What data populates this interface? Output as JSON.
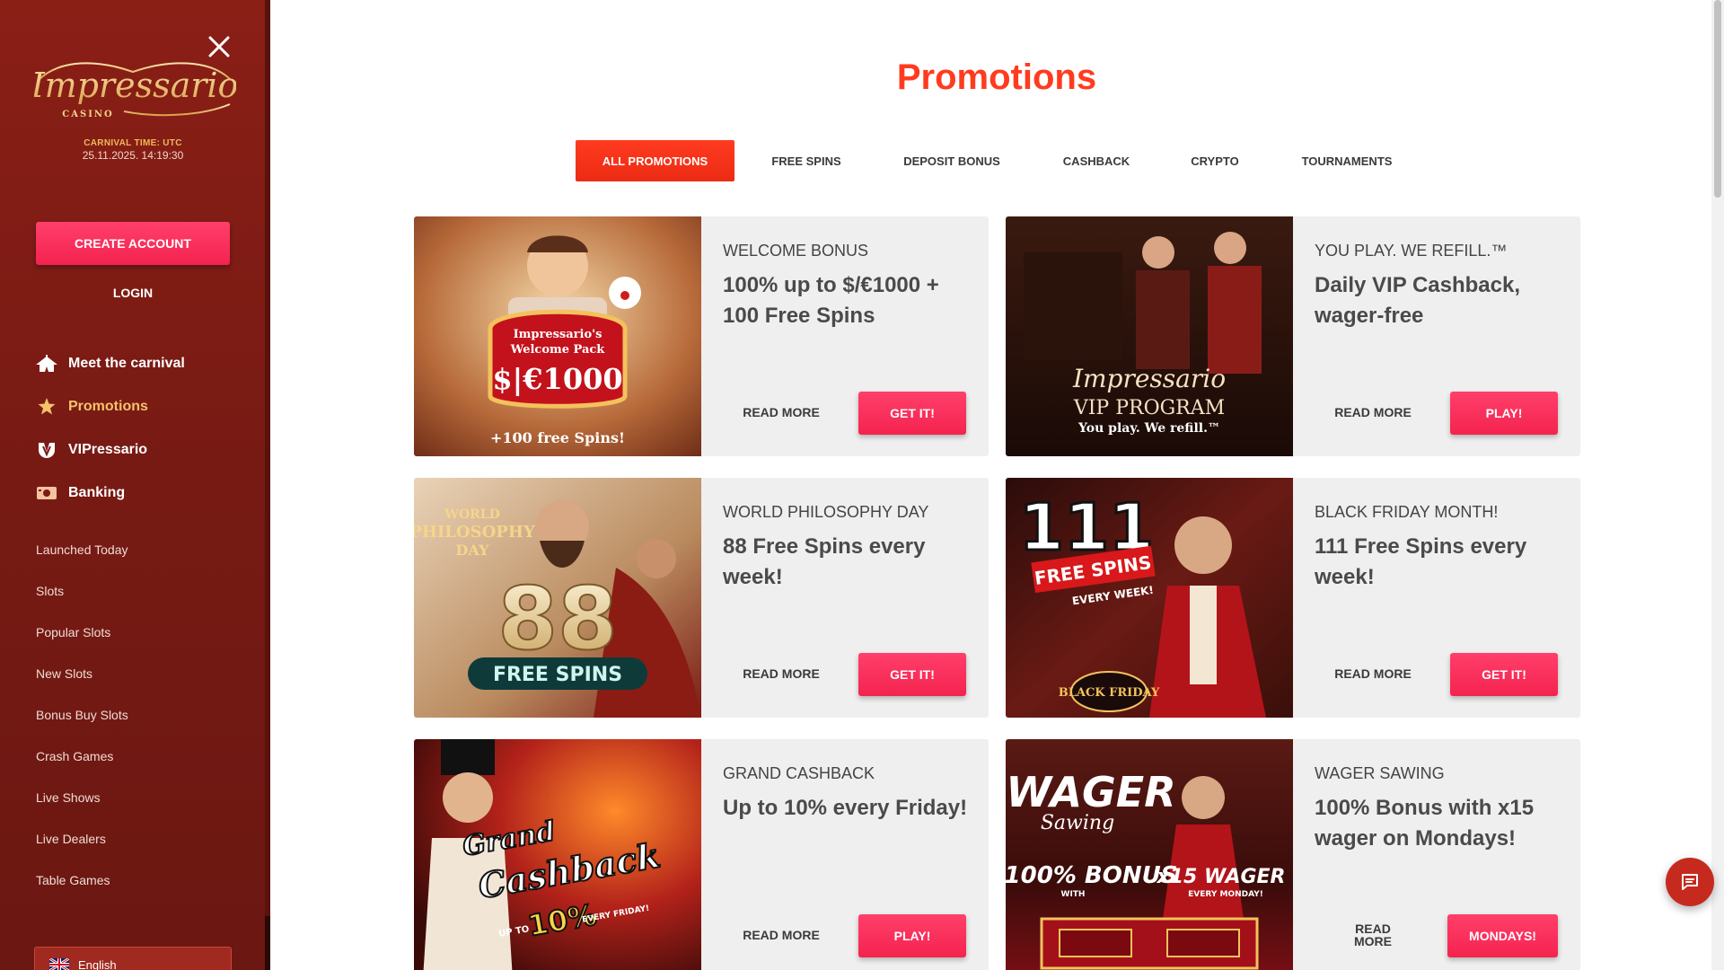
{
  "sidebar": {
    "logo_text": "Impressario",
    "logo_subtext": "CASINO",
    "carnival_time_label": "CARNIVAL TIME: UTC",
    "carnival_time_value": "25.11.2025. 14:19:30",
    "create_account_label": "CREATE ACCOUNT",
    "login_label": "LOGIN",
    "main_nav": [
      {
        "label": "Meet the carnival",
        "icon": "circus-tent-icon"
      },
      {
        "label": "Promotions",
        "icon": "star-badge-icon",
        "active": true
      },
      {
        "label": "VIPressario",
        "icon": "vip-crest-icon"
      },
      {
        "label": "Banking",
        "icon": "cash-icon"
      }
    ],
    "sub_nav": [
      "Launched Today",
      "Slots",
      "Popular Slots",
      "New Slots",
      "Bonus Buy Slots",
      "Crash Games",
      "Live Shows",
      "Live Dealers",
      "Table Games"
    ],
    "language": "English"
  },
  "main": {
    "title": "Promotions",
    "tabs": [
      {
        "label": "ALL PROMOTIONS",
        "active": true
      },
      {
        "label": "FREE SPINS"
      },
      {
        "label": "DEPOSIT BONUS"
      },
      {
        "label": "CASHBACK"
      },
      {
        "label": "CRYPTO"
      },
      {
        "label": "TOURNAMENTS"
      }
    ],
    "cards": [
      {
        "category": "WELCOME BONUS",
        "title": "100% up to $/€1000 + 100 Free Spins",
        "read_more": "READ MORE",
        "cta": "GET IT!",
        "image_text": [
          "Impressario's",
          "Welcome Pack",
          "$|€1000",
          "+100 free Spins!"
        ]
      },
      {
        "category": "YOU PLAY. WE REFILL.™",
        "title": "Daily VIP Cashback, wager-free",
        "read_more": "READ MORE",
        "cta": "PLAY!",
        "image_text": [
          "Impressario",
          "VIP PROGRAM",
          "You play. We refill.™"
        ]
      },
      {
        "category": "WORLD PHILOSOPHY DAY",
        "title": "88 Free Spins every week!",
        "read_more": "READ MORE",
        "cta": "GET IT!",
        "image_text": [
          "WORLD",
          "PHILOSOPHY",
          "DAY",
          "88",
          "FREE SPINS"
        ]
      },
      {
        "category": "BLACK FRIDAY MONTH!",
        "title": "111 Free Spins every week!",
        "read_more": "READ MORE",
        "cta": "GET IT!",
        "image_text": [
          "111",
          "FREE SPINS",
          "EVERY WEEK!",
          "BLACK FRIDAY"
        ]
      },
      {
        "category": "GRAND CASHBACK",
        "title": "Up to 10% every Friday!",
        "read_more": "READ MORE",
        "cta": "PLAY!",
        "image_text": [
          "Grand",
          "Cashback",
          "UP TO",
          "10%",
          "EVERY FRIDAY!"
        ]
      },
      {
        "category": "WAGER SAWING",
        "title": "100% Bonus with x15 wager on Mondays!",
        "read_more_line1": "READ",
        "read_more_line2": "MORE",
        "cta": "MONDAYS!",
        "image_text": [
          "WAGER",
          "Sawing",
          "100% BONUS",
          "WITH",
          "x15 WAGER",
          "EVERY MONDAY!"
        ]
      }
    ]
  },
  "colors": {
    "sidebar_bg": "#7a1b14",
    "accent_red": "#ff3b1f",
    "cta_pink": "#f4234f",
    "gold": "#f4c36a"
  }
}
